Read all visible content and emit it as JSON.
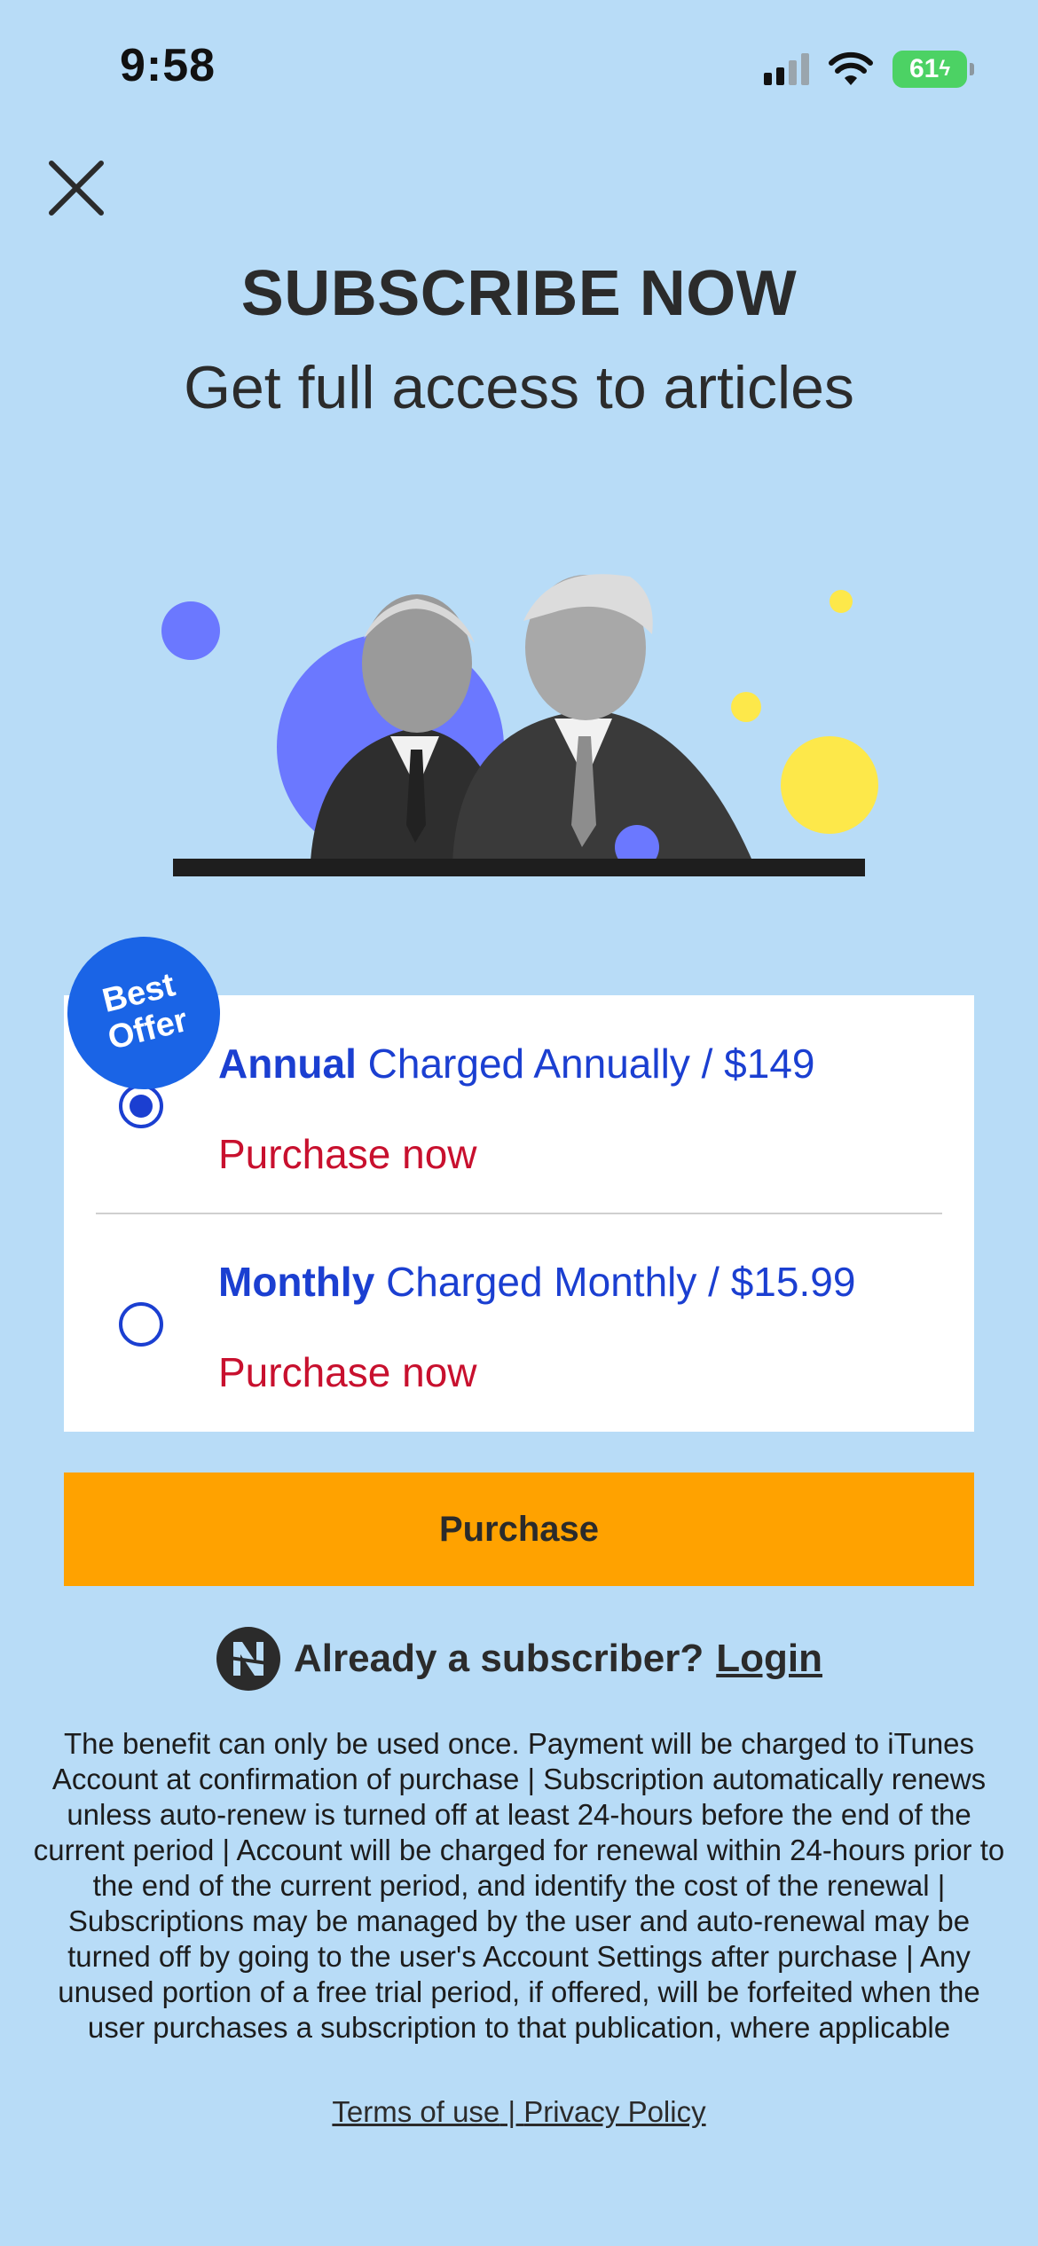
{
  "status_bar": {
    "time": "9:58",
    "battery": "61"
  },
  "header": {
    "title": "SUBSCRIBE NOW",
    "subtitle": "Get full access to articles"
  },
  "badge": {
    "line1": "Best",
    "line2": "Offer"
  },
  "plans": [
    {
      "name": "Annual",
      "detail": "Charged Annually / $149",
      "cta": "Purchase now",
      "selected": true
    },
    {
      "name": "Monthly",
      "detail": "Charged Monthly / $15.99",
      "cta": "Purchase now",
      "selected": false
    }
  ],
  "purchase_button": "Purchase",
  "login": {
    "prompt": "Already a subscriber?",
    "link": "Login"
  },
  "legal_text": "The benefit can only be used once. Payment will be charged to iTunes Account at confirmation of purchase | Subscription automatically renews unless auto-renew is turned off at least 24-hours before the end of the current period | Account will be charged for renewal within 24-hours prior to the end of the current period, and identify the cost of the renewal | Subscriptions may be managed by the user and auto-renewal may be turned off by going to the user's Account Settings after purchase | Any unused portion of a free trial period, if offered, will be forfeited when the user purchases a subscription to that publication, where applicable",
  "footer": {
    "terms": "Terms of use",
    "separator": " | ",
    "privacy": "Privacy Policy"
  },
  "colors": {
    "background": "#b8dcf7",
    "accent_blue": "#1b3fd1",
    "cta_red": "#c8102e",
    "button_orange": "#ffa200"
  }
}
